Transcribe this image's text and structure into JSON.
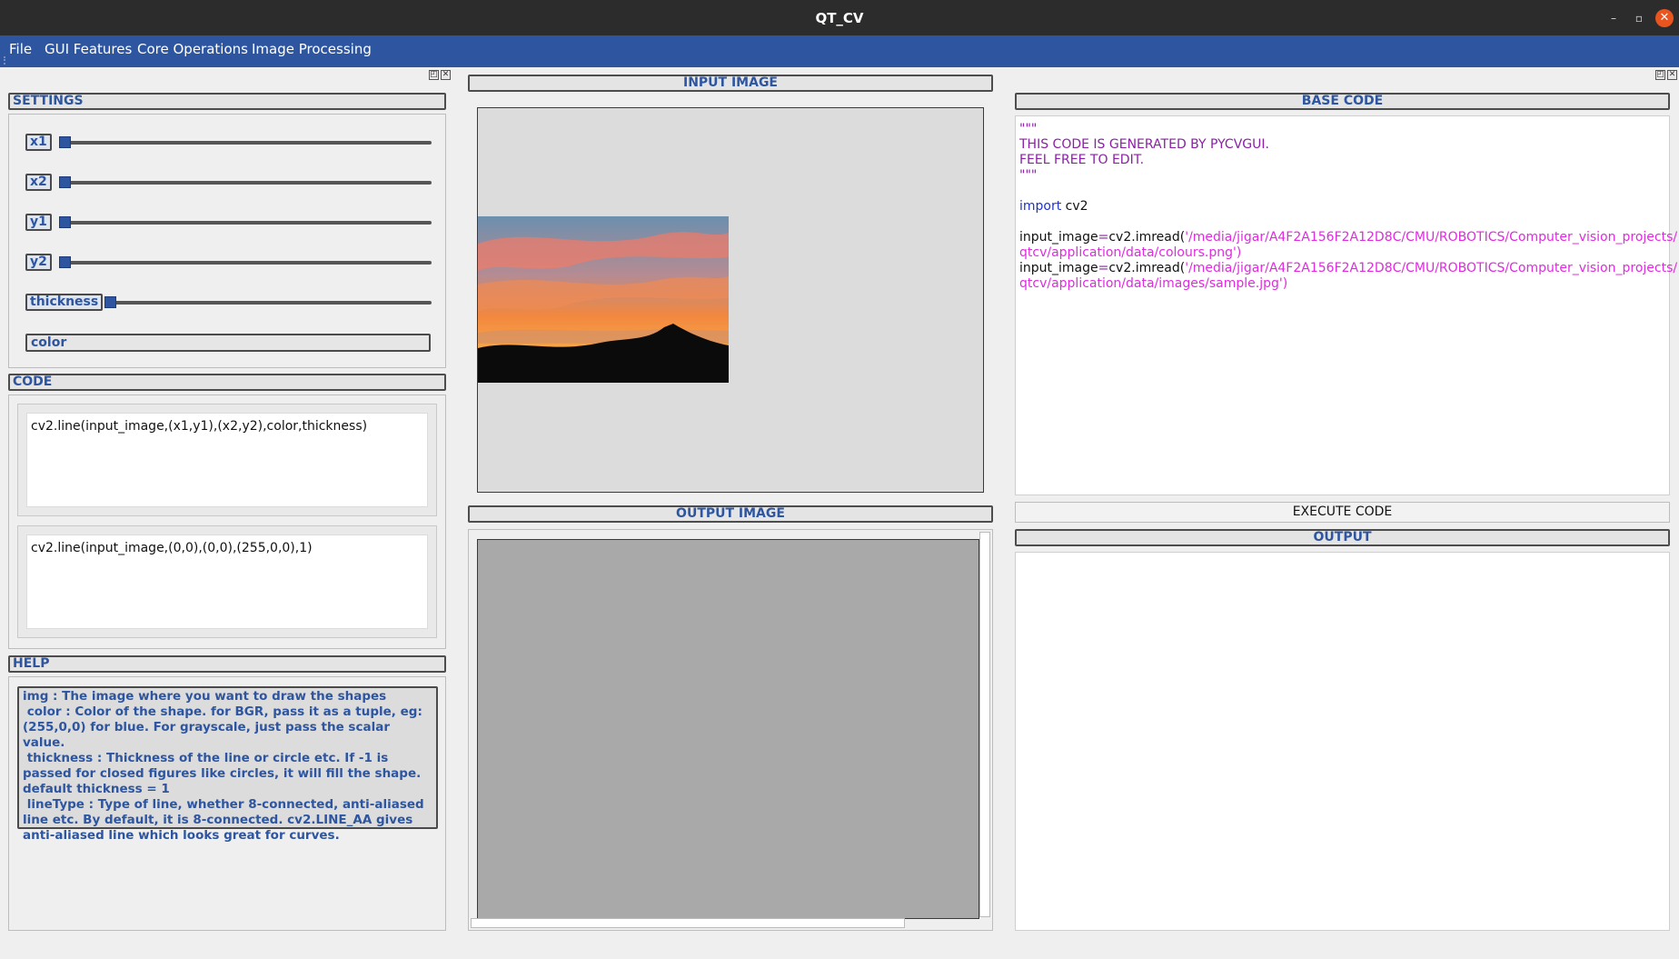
{
  "window": {
    "title": "QT_CV",
    "minimize": "–",
    "maximize": "▫",
    "close": "✕"
  },
  "menu": [
    "File",
    "GUI Features",
    "Core Operations",
    "Image Processing"
  ],
  "dock_buttons": {
    "float": "◰",
    "close": "✕"
  },
  "settings": {
    "header": "SETTINGS",
    "sliders": [
      {
        "label": "x1",
        "value": 0
      },
      {
        "label": "x2",
        "value": 0
      },
      {
        "label": "y1",
        "value": 0
      },
      {
        "label": "y2",
        "value": 0
      },
      {
        "label": "thickness",
        "value": 0
      }
    ],
    "color_button": "color"
  },
  "code": {
    "header": "CODE",
    "template": "cv2.line(input_image,(x1,y1),(x2,y2),color,thickness)",
    "filled": "cv2.line(input_image,(0,0),(0,0),(255,0,0),1)"
  },
  "help": {
    "header": "HELP",
    "text": "img : The image where you want to draw the shapes\n color : Color of the shape. for BGR, pass it as a tuple, eg: (255,0,0) for blue. For grayscale, just pass the scalar value.\n thickness : Thickness of the line or circle etc. If -1 is passed for closed figures like circles, it will fill the shape. default thickness = 1\n lineType : Type of line, whether 8-connected, anti-aliased line etc. By default, it is 8-connected. cv2.LINE_AA gives anti-aliased line which looks great for curves."
  },
  "input_image": {
    "header": "INPUT IMAGE"
  },
  "output_image": {
    "header": "OUTPUT IMAGE"
  },
  "base_code": {
    "header": "BASE CODE",
    "docstring_open": "\"\"\"",
    "comment1": "THIS CODE IS GENERATED BY PYCVGUI.",
    "comment2": "FEEL FREE TO EDIT.",
    "docstring_close": "\"\"\"",
    "import_kw": "import",
    "import_mod": " cv2",
    "assign1": "input_image",
    "eq": "=",
    "call": "cv2.imread(",
    "path1a": "'/media/jigar/A4F2A156F2A12D8C/CMU/ROBOTICS/Computer_vision_projects/",
    "path1b": "qtcv/application/data/colours.png'",
    "path2a": "'/media/jigar/A4F2A156F2A12D8C/CMU/ROBOTICS/Computer_vision_projects/",
    "path2b": "qtcv/application/data/images/sample.jpg'",
    "close_paren": ")"
  },
  "execute_button": "EXECUTE CODE",
  "output": {
    "header": "OUTPUT"
  },
  "colors": {
    "accent": "#2d55a0",
    "titlebar": "#2c2c2c",
    "close": "#e9541f"
  }
}
